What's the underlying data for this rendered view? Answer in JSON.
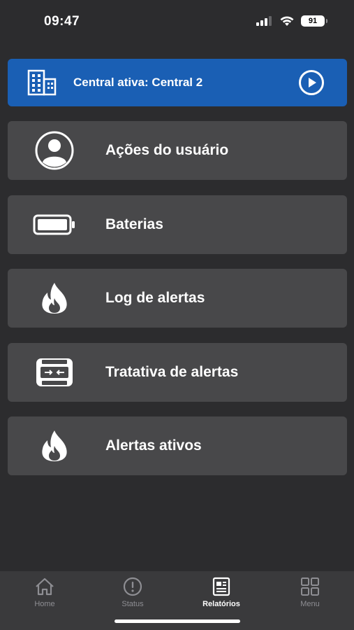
{
  "status_bar": {
    "time": "09:47",
    "battery": "91",
    "icons": [
      "signal-icon",
      "wifi-icon",
      "battery-icon"
    ]
  },
  "central": {
    "label": "Central ativa: Central 2",
    "icons": [
      "building-icon",
      "play-icon"
    ],
    "color": "#1a5fb4"
  },
  "menu": {
    "items": [
      {
        "label": "Ações do usuário",
        "icon": "user-icon"
      },
      {
        "label": "Baterias",
        "icon": "battery-icon"
      },
      {
        "label": "Log de alertas",
        "icon": "fire-icon"
      },
      {
        "label": "Tratativa de alertas",
        "icon": "panel-device-icon"
      },
      {
        "label": "Alertas ativos",
        "icon": "fire-icon"
      }
    ]
  },
  "tabs": [
    {
      "label": "Home",
      "icon": "home-icon",
      "active": false
    },
    {
      "label": "Status",
      "icon": "alert-circle-icon",
      "active": false
    },
    {
      "label": "Relatórios",
      "icon": "report-icon",
      "active": true
    },
    {
      "label": "Menu",
      "icon": "grid-icon",
      "active": false
    }
  ],
  "colors": {
    "background": "#2c2c2e",
    "card": "#48484a",
    "tab_bar": "#3a3a3c",
    "inactive": "#8e8e93"
  }
}
